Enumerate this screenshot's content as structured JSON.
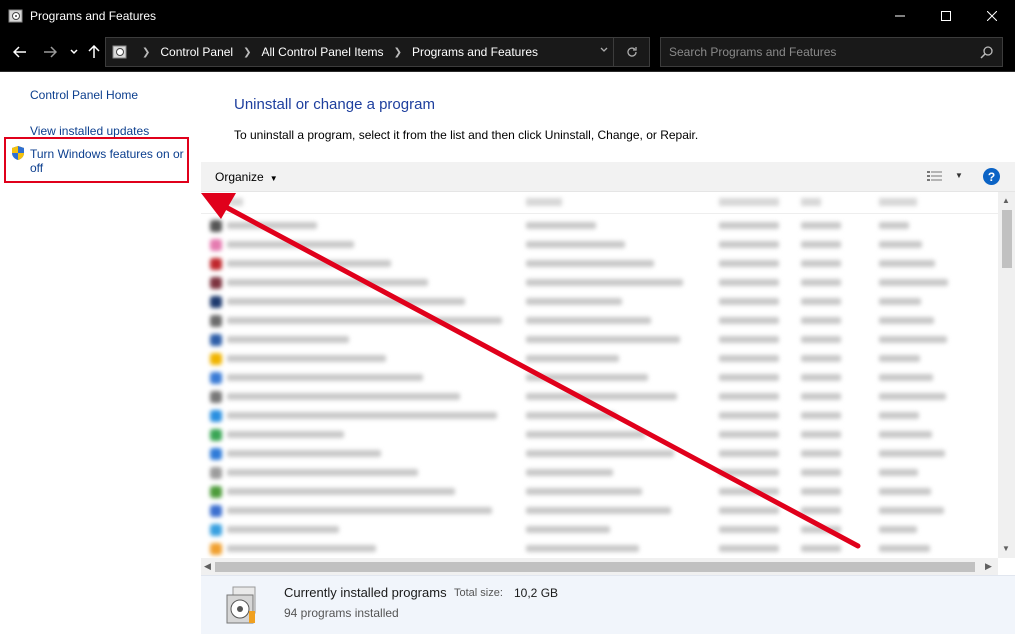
{
  "window": {
    "title": "Programs and Features",
    "minimize_icon": "minimize-icon",
    "maximize_icon": "maximize-icon",
    "close_icon": "close-icon"
  },
  "address": {
    "crumbs": [
      "Control Panel",
      "All Control Panel Items",
      "Programs and Features"
    ]
  },
  "search": {
    "placeholder": "Search Programs and Features"
  },
  "sidebar": {
    "items": [
      {
        "label": "Control Panel Home"
      },
      {
        "label": "View installed updates"
      },
      {
        "label": "Turn Windows features on or off"
      }
    ]
  },
  "main": {
    "heading": "Uninstall or change a program",
    "subtext": "To uninstall a program, select it from the list and then click Uninstall, Change, or Repair.",
    "toolbar": {
      "organize_label": "Organize",
      "help_label": "?"
    }
  },
  "status": {
    "title": "Currently installed programs",
    "total_size_label": "Total size:",
    "total_size_value": "10,2 GB",
    "count": "94 programs installed"
  },
  "colors": {
    "link": "#0b3e8e",
    "heading": "#1e3f9e",
    "highlight": "#e0001b",
    "arrow": "#e0001b"
  }
}
